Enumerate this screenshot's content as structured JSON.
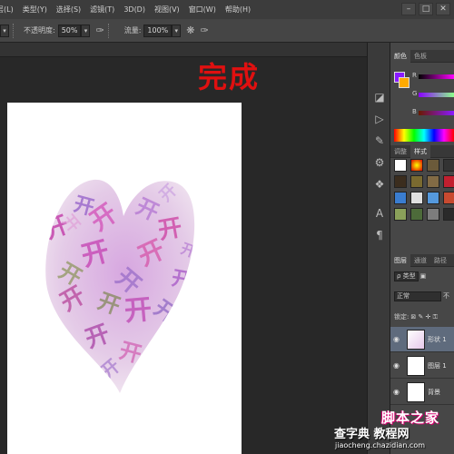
{
  "menu": {
    "items": [
      "层(L)",
      "类型(Y)",
      "选择(S)",
      "滤镜(T)",
      "3D(D)",
      "视图(V)",
      "窗口(W)",
      "帮助(H)"
    ],
    "minimize": "–",
    "maximize": "□",
    "close": "✕"
  },
  "options": {
    "mode_value": "",
    "opacity_label": "不透明度:",
    "opacity_value": "50%",
    "flow_label": "流量:",
    "flow_value": "100%"
  },
  "canvas": {
    "overlay_title": "完成",
    "overlay_color": "#e01010"
  },
  "panels": {
    "color_tabs": [
      "颜色",
      "色板"
    ],
    "rgb": [
      "R",
      "G",
      "B"
    ],
    "style_tabs": [
      "调整",
      "样式"
    ],
    "layer_tabs": [
      "图层",
      "通道",
      "路径"
    ],
    "kind_label": "ρ 类型",
    "blend_mode": "正常",
    "opacity_short": "不",
    "lock_label": "锁定:",
    "lock_symbols": "⊠ ✎ ✛ ⚿",
    "layers": [
      {
        "name": "形状 1",
        "selected": true
      },
      {
        "name": "图层 1",
        "selected": false
      },
      {
        "name": "背景",
        "selected": false
      }
    ],
    "foreground_color": "#8a1aff",
    "background_color": "#ffaa00"
  },
  "watermark": {
    "logo_text": "脚本之家",
    "site_text": "查字典 教程网",
    "url_text": "jiaocheng.chazidian.com"
  }
}
